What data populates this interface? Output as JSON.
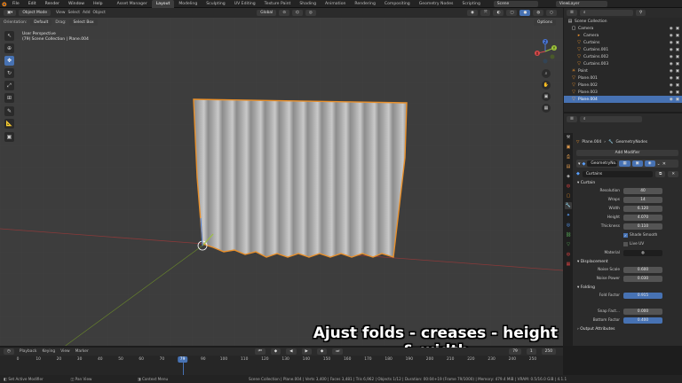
{
  "menus": [
    "File",
    "Edit",
    "Render",
    "Window",
    "Help"
  ],
  "workspaces": [
    "Asset Manager",
    "Layout",
    "Modeling",
    "Sculpting",
    "UV Editing",
    "Texture Paint",
    "Shading",
    "Animation",
    "Rendering",
    "Compositing",
    "Geometry Nodes",
    "Scripting"
  ],
  "scene": "Scene",
  "view_layer": "ViewLayer",
  "header": {
    "mode": "Object Mode",
    "menus": [
      "View",
      "Select",
      "Add",
      "Object"
    ],
    "transform": "Global"
  },
  "header2": {
    "orientation_label": "Orientation:",
    "orientation": "Default",
    "drag_label": "Drag:",
    "drag": "Select Box",
    "options": "Options"
  },
  "viewport_info": {
    "line1": "User Perspective",
    "line2": "(79) Scene Collection | Plane.004"
  },
  "gizmo": {
    "z": "Z",
    "y": "Y",
    "x": "X"
  },
  "caption": {
    "line1": "Ajust folds - creases - height",
    "line2": "& width"
  },
  "outliner": {
    "search_placeholder": "",
    "title": "Scene Collection",
    "items": [
      {
        "name": "Camera",
        "indent": 0
      },
      {
        "name": "Camera",
        "indent": 1
      },
      {
        "name": "Curtains",
        "indent": 1
      },
      {
        "name": "Curtains.001",
        "indent": 1
      },
      {
        "name": "Curtains.002",
        "indent": 1
      },
      {
        "name": "Curtains.003",
        "indent": 1
      },
      {
        "name": "Point",
        "indent": 0
      },
      {
        "name": "Plane.001",
        "indent": 0
      },
      {
        "name": "Plane.002",
        "indent": 0
      },
      {
        "name": "Plane.003",
        "indent": 0
      },
      {
        "name": "Plane.004",
        "indent": 0,
        "selected": true
      }
    ]
  },
  "properties": {
    "object": "Plane.004",
    "modifier": "GeometryNodes",
    "add_modifier": "Add Modifier",
    "mod_name": "GeometryNo...",
    "node_group": "Curtains",
    "section": "Curtain",
    "fields": [
      {
        "label": "Resolution",
        "value": "40"
      },
      {
        "label": "Wraps",
        "value": "14"
      },
      {
        "label": "Width",
        "value": "6.120"
      },
      {
        "label": "Height",
        "value": "4.070"
      },
      {
        "label": "Thickness",
        "value": "0.110"
      }
    ],
    "shade_smooth": "Shade Smooth",
    "live_uv": "Live UV",
    "material_label": "Material",
    "displacement": "Displacement",
    "disp_fields": [
      {
        "label": "Noise Scale",
        "value": "0.600"
      },
      {
        "label": "Noise Power",
        "value": "0.030"
      }
    ],
    "folding": "Folding",
    "fold_fields": [
      {
        "label": "Fold Factor",
        "value": "0.915"
      },
      {
        "label": "Snap Fact...",
        "value": "0.000"
      },
      {
        "label": "Bottom Factor",
        "value": "0.400"
      }
    ],
    "output": "Output Attributes"
  },
  "timeline": {
    "menus": [
      "Playback",
      "Keying",
      "View",
      "Marker"
    ],
    "current_frame": "79",
    "start": "1",
    "end": "250",
    "ticks": [
      "0",
      "10",
      "20",
      "30",
      "40",
      "50",
      "60",
      "70",
      "79",
      "90",
      "100",
      "110",
      "120",
      "130",
      "140",
      "150",
      "160",
      "170",
      "180",
      "190",
      "200",
      "210",
      "220",
      "230",
      "240",
      "250"
    ]
  },
  "status": {
    "left": "Set Active Modifier",
    "middle": "Pan View",
    "context": "Context Menu",
    "right": "Scene Collection | Plane.004 | Verts 3,400 | Faces 3,481 | Tris 6,962 | Objects 1/12 | Duration: 00:04+19 (Frame 79/1000) | Memory: 479.4 MiB | VRAM: 0.5/16.0 GiB | 4.1.1"
  }
}
